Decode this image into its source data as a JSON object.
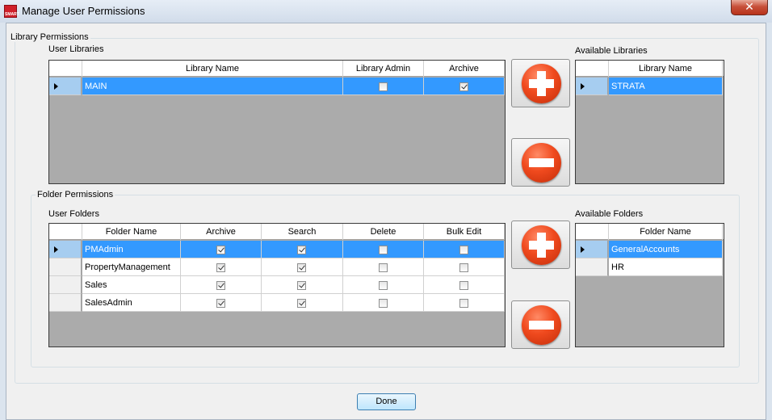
{
  "window": {
    "title": "Manage User Permissions",
    "app_icon_text": "SMART",
    "close_glyph": "✕"
  },
  "library_section": {
    "group_label": "Library Permissions",
    "user_libraries": {
      "label": "User Libraries",
      "columns": [
        "Library Name",
        "Library Admin",
        "Archive"
      ],
      "rows": [
        {
          "name": "MAIN",
          "library_admin": false,
          "archive": true,
          "selected": true
        }
      ]
    },
    "available_libraries": {
      "label": "Available Libraries",
      "columns": [
        "Library Name"
      ],
      "rows": [
        {
          "name": "STRATA",
          "selected": true
        }
      ]
    }
  },
  "folder_section": {
    "group_label": "Folder Permissions",
    "user_folders": {
      "label": "User Folders",
      "columns": [
        "Folder Name",
        "Archive",
        "Search",
        "Delete",
        "Bulk Edit"
      ],
      "rows": [
        {
          "name": "PMAdmin",
          "archive": true,
          "search": true,
          "delete": false,
          "bulk_edit": false,
          "selected": true
        },
        {
          "name": "PropertyManagement",
          "archive": true,
          "search": true,
          "delete": false,
          "bulk_edit": false,
          "selected": false
        },
        {
          "name": "Sales",
          "archive": true,
          "search": true,
          "delete": false,
          "bulk_edit": false,
          "selected": false
        },
        {
          "name": "SalesAdmin",
          "archive": true,
          "search": true,
          "delete": false,
          "bulk_edit": false,
          "selected": false
        }
      ]
    },
    "available_folders": {
      "label": "Available Folders",
      "columns": [
        "Folder Name"
      ],
      "rows": [
        {
          "name": "GeneralAccounts",
          "selected": true
        },
        {
          "name": "HR",
          "selected": false
        }
      ]
    }
  },
  "buttons": {
    "add_icon": "plus-circle-icon",
    "remove_icon": "minus-circle-icon",
    "done_label": "Done"
  },
  "colors": {
    "selection": "#3399ff",
    "grid_background": "#ababab",
    "icon_red": "#f04a1e"
  }
}
